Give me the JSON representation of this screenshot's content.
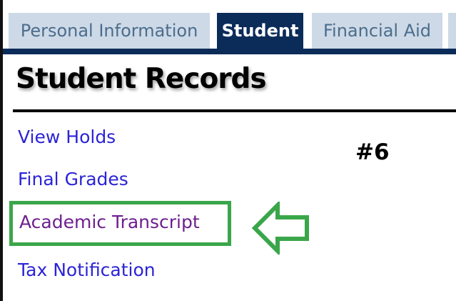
{
  "tabs": [
    {
      "label": "Personal Information",
      "active": false
    },
    {
      "label": "Student",
      "active": true
    },
    {
      "label": "Financial Aid",
      "active": false
    }
  ],
  "page": {
    "title": "Student Records"
  },
  "links": [
    {
      "label": "View Holds"
    },
    {
      "label": "Final Grades"
    },
    {
      "label": "Academic Transcript",
      "visited": true,
      "highlighted": true
    },
    {
      "label": "Tax Notification"
    }
  ],
  "annotation": {
    "step_label": "#6",
    "highlight_color": "#3aa64a",
    "arrow_icon": "left-arrow-icon"
  },
  "colors": {
    "nav_dark": "#0b2c59",
    "tab_inactive_bg": "#cdd9e6",
    "tab_inactive_text": "#4b6d8d",
    "link_blue": "#2b24d6",
    "link_visited": "#6e1f8f"
  }
}
